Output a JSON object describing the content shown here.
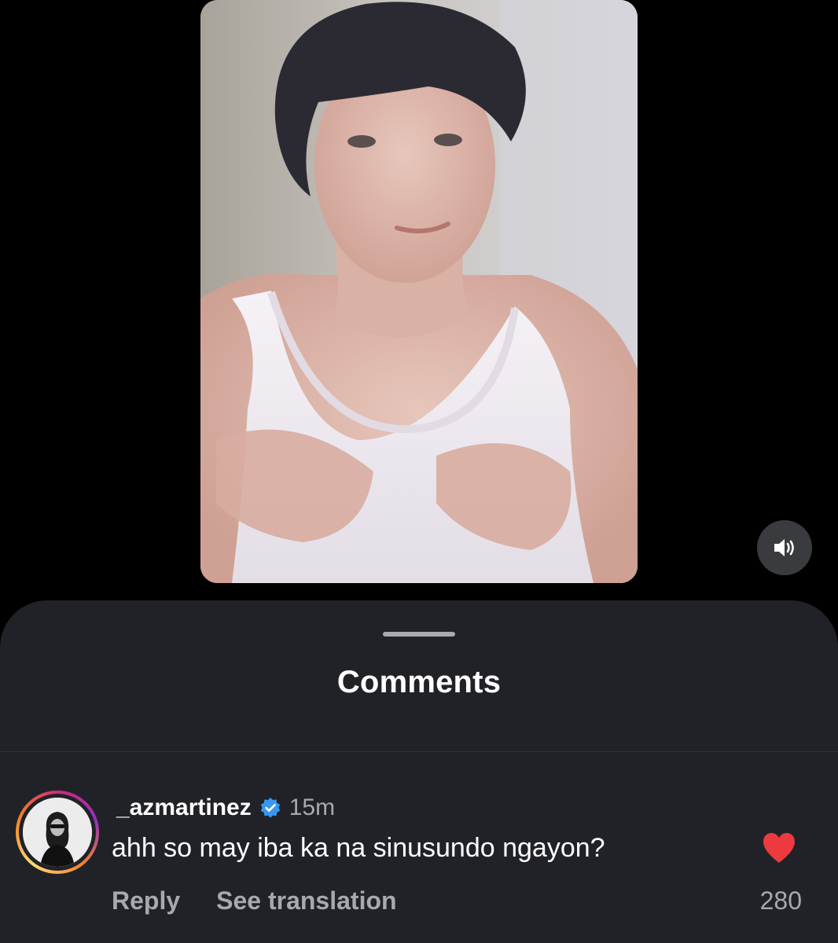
{
  "reel": {
    "video_description": "",
    "sound_icon": "speaker-on-icon"
  },
  "comments_sheet": {
    "title": "Comments",
    "comments": [
      {
        "username": "_azmartinez",
        "verified": true,
        "time": "15m",
        "text": "ahh so may iba ka na sinusundo ngayon?",
        "reply_label": "Reply",
        "translate_label": "See translation",
        "likes": "280",
        "liked": true
      }
    ]
  },
  "colors": {
    "background": "#000000",
    "sheet": "#212228",
    "like_red": "#ed3a3f",
    "verified_blue": "#3897f0",
    "secondary_text": "#a8a9ae"
  }
}
